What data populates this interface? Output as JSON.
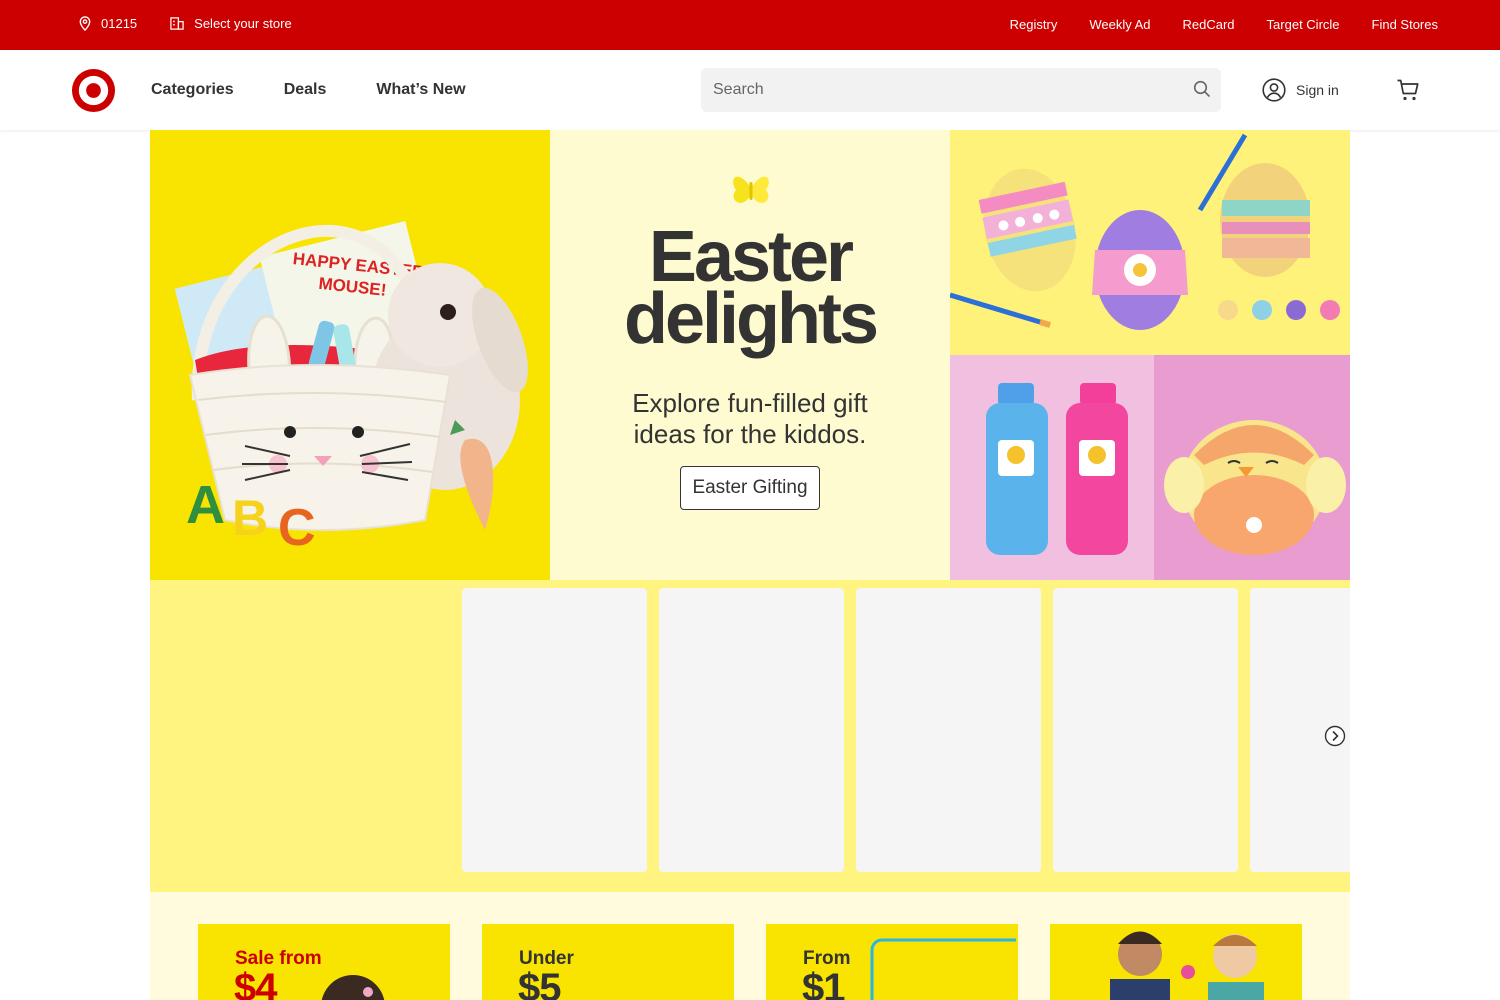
{
  "utility": {
    "zip": "01215",
    "store": "Select your store",
    "links": [
      "Registry",
      "Weekly Ad",
      "RedCard",
      "Target Circle",
      "Find Stores"
    ]
  },
  "header": {
    "nav": [
      "Categories",
      "Deals",
      "What’s New"
    ],
    "search_placeholder": "Search",
    "signin": "Sign in"
  },
  "hero": {
    "title_line1": "Easter",
    "title_line2": "delights",
    "subtitle_line1": "Explore fun-filled gift",
    "subtitle_line2": "ideas for the kiddos.",
    "button": "Easter Gifting",
    "basket_card_text_line1": "HAPPY EASTER",
    "basket_card_text_line2": "MOUSE!"
  },
  "deals": [
    {
      "label": "Sale from",
      "big": "$4"
    },
    {
      "label": "Under",
      "big": "$5"
    },
    {
      "label": "From",
      "big": "$1"
    },
    {
      "label": "",
      "big": ""
    }
  ],
  "colors": {
    "brand_red": "#cc0000",
    "hero_yellow": "#f8e400",
    "carousel_yellow": "#fff47f",
    "cream": "#fffbd0"
  }
}
